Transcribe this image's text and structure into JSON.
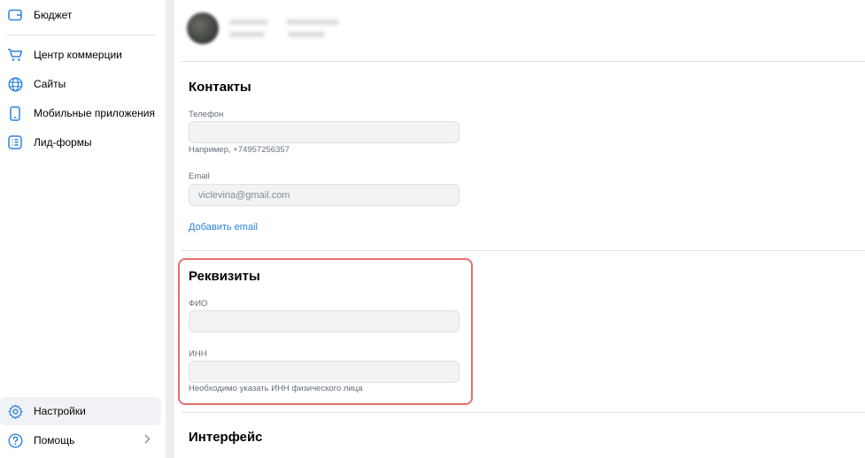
{
  "sidebar": {
    "items": [
      {
        "label": "Бюджет",
        "icon": "wallet-icon"
      },
      {
        "label": "Центр коммерции",
        "icon": "cart-icon"
      },
      {
        "label": "Сайты",
        "icon": "globe-icon"
      },
      {
        "label": "Мобильные приложения",
        "icon": "phone-icon"
      },
      {
        "label": "Лид-формы",
        "icon": "form-icon"
      }
    ],
    "bottom": [
      {
        "label": "Настройки",
        "icon": "gear-icon"
      },
      {
        "label": "Помощь",
        "icon": "help-icon"
      }
    ]
  },
  "contacts": {
    "title": "Контакты",
    "phone_label": "Телефон",
    "phone_value": "",
    "phone_hint": "Например, +74957256357",
    "email_label": "Email",
    "email_value": "viclevina@gmail.com",
    "add_email": "Добавить email"
  },
  "requisites": {
    "title": "Реквизиты",
    "fio_label": "ФИО",
    "fio_value": "",
    "inn_label": "ИНН",
    "inn_value": "",
    "inn_hint": "Необходимо указать ИНН физического лица"
  },
  "interface": {
    "title": "Интерфейс"
  },
  "colors": {
    "accent": "#2d81e0",
    "highlight": "#ea6e6e"
  }
}
